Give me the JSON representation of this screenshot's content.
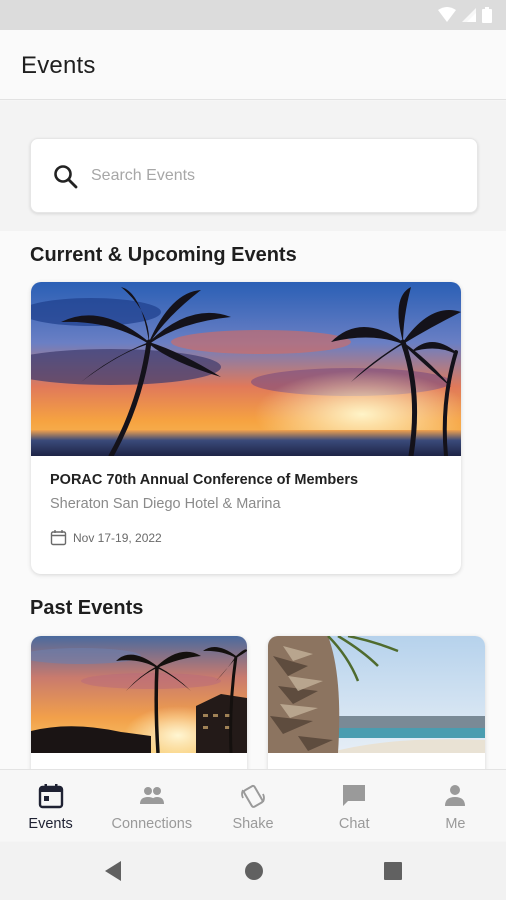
{
  "app_bar": {
    "title": "Events"
  },
  "search": {
    "placeholder": "Search Events"
  },
  "sections": {
    "current_title": "Current & Upcoming Events",
    "past_title": "Past Events"
  },
  "current_event": {
    "title": "PORAC 70th Annual Conference of Members",
    "venue": "Sheraton San Diego Hotel & Marina",
    "date": "Nov 17-19, 2022"
  },
  "bottom_nav": {
    "items": [
      {
        "label": "Events",
        "icon": "calendar-icon",
        "active": true
      },
      {
        "label": "Connections",
        "icon": "people-icon",
        "active": false
      },
      {
        "label": "Shake",
        "icon": "shake-phone-icon",
        "active": false
      },
      {
        "label": "Chat",
        "icon": "chat-icon",
        "active": false
      },
      {
        "label": "Me",
        "icon": "person-icon",
        "active": false
      }
    ]
  },
  "colors": {
    "accent": "#1f2233",
    "inactive": "#9a9a9a"
  }
}
